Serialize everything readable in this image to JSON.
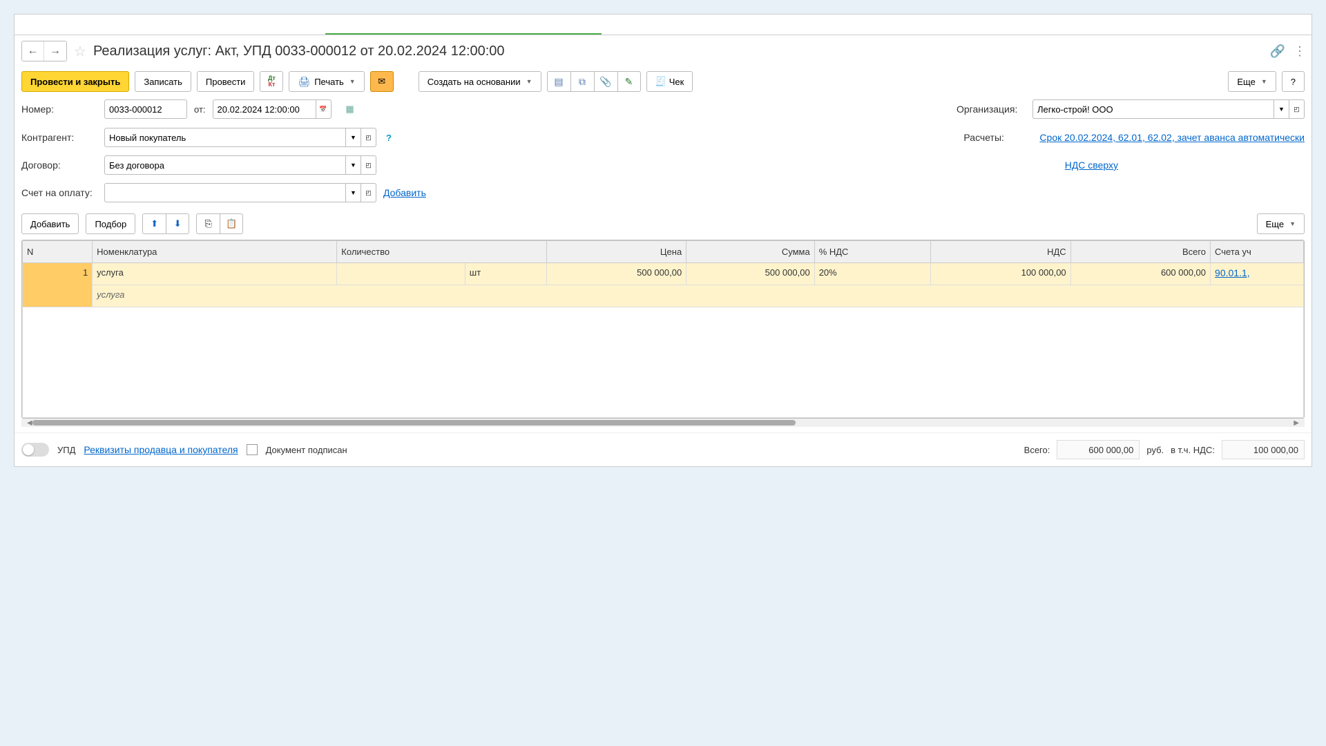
{
  "header": {
    "title": "Реализация услуг: Акт, УПД 0033-000012 от 20.02.2024 12:00:00"
  },
  "toolbar": {
    "post_close": "Провести и закрыть",
    "save": "Записать",
    "post": "Провести",
    "print": "Печать",
    "create_based": "Создать на основании",
    "check": "Чек",
    "more": "Еще",
    "help": "?"
  },
  "form": {
    "number_label": "Номер:",
    "number_value": "0033-000012",
    "from_label": "от:",
    "date_value": "20.02.2024 12:00:00",
    "org_label": "Организация:",
    "org_value": "Легко-строй! ООО",
    "contragent_label": "Контрагент:",
    "contragent_value": "Новый покупатель",
    "calc_label": "Расчеты:",
    "calc_link": "Срок 20.02.2024, 62.01, 62.02, зачет аванса автоматически",
    "contract_label": "Договор:",
    "contract_value": "Без договора",
    "vat_link": "НДС сверху",
    "invoice_label": "Счет на оплату:",
    "invoice_value": "",
    "add_link": "Добавить"
  },
  "table_toolbar": {
    "add": "Добавить",
    "pick": "Подбор",
    "more": "Еще"
  },
  "table": {
    "headers": {
      "n": "N",
      "nomenclature": "Номенклатура",
      "qty": "Количество",
      "price": "Цена",
      "sum": "Сумма",
      "vat_pct": "% НДС",
      "vat": "НДС",
      "total": "Всего",
      "accounts": "Счета уч"
    },
    "rows": [
      {
        "n": "1",
        "nomenclature": "услуга",
        "nomenclature_sub": "услуга",
        "qty": "",
        "unit": "шт",
        "price": "500 000,00",
        "sum": "500 000,00",
        "vat_pct": "20%",
        "vat": "100 000,00",
        "total": "600 000,00",
        "accounts": "90.01.1,"
      }
    ]
  },
  "footer": {
    "upd_label": "УПД",
    "seller_link": "Реквизиты продавца и покупателя",
    "signed_label": "Документ подписан",
    "total_label": "Всего:",
    "total_value": "600 000,00",
    "currency": "руб.",
    "vat_label": "в т.ч. НДС:",
    "vat_value": "100 000,00"
  }
}
